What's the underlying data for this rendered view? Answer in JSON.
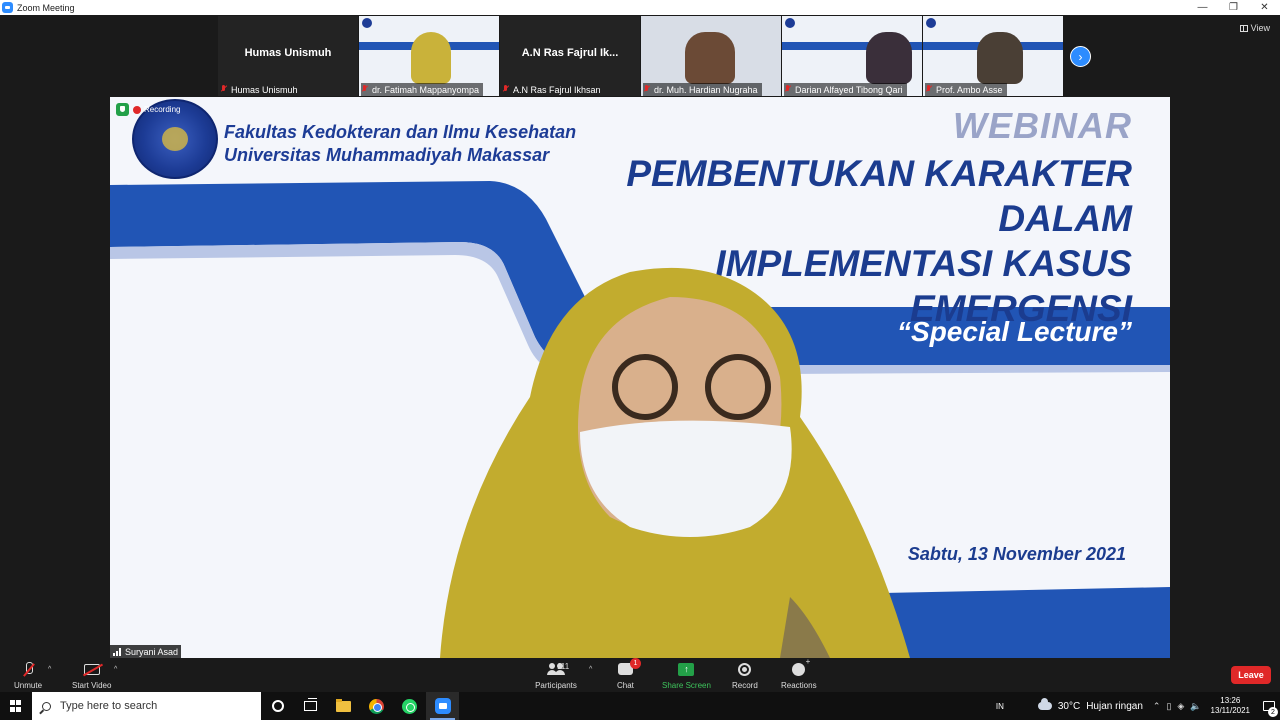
{
  "window": {
    "title": "Zoom Meeting",
    "controls": [
      "—",
      "❐",
      "✕"
    ]
  },
  "view_button": {
    "label": "View"
  },
  "participants_strip": [
    {
      "name": "Humas Unismuh",
      "caption": "Humas Unismuh",
      "video": false
    },
    {
      "caption": "dr. Fatimah Mappanyompa",
      "video": true
    },
    {
      "name": "A.N Ras Fajrul Ik...",
      "caption": "A.N Ras Fajrul Ikhsan",
      "video": false
    },
    {
      "caption": "dr. Muh. Hardian Nugraha",
      "video": true
    },
    {
      "caption": "Darian Alfayed Tibong Qari",
      "video": true
    },
    {
      "caption": "Prof. Ambo Asse",
      "video": true
    }
  ],
  "main_video": {
    "recording_label": "Recording",
    "speaker_name": "Suryani Asad",
    "slide": {
      "faculty_line1": "Fakultas Kedokteran dan Ilmu Kesehatan",
      "faculty_line2": "Universitas Muhammadiyah Makassar",
      "webinar": "WEBINAR",
      "title_line1": "PEMBENTUKAN KARAKTER DALAM",
      "title_line2": "IMPLEMENTASI KASUS",
      "title_line3": "EMERGENSI",
      "special": "“Special Lecture”",
      "date": "Sabtu, 13 November 2021"
    }
  },
  "toolbar": {
    "unmute": "Unmute",
    "start_video": "Start Video",
    "participants": "Participants",
    "participants_count": "111",
    "chat": "Chat",
    "chat_badge": "1",
    "share_screen": "Share Screen",
    "record": "Record",
    "reactions": "Reactions",
    "leave": "Leave"
  },
  "taskbar": {
    "search_placeholder": "Type here to search",
    "language": "IN",
    "temperature": "30°C",
    "weather": "Hujan ringan",
    "time": "13:26",
    "date": "13/11/2021",
    "notification_count": "2"
  },
  "colors": {
    "zoom_blue": "#2d8cff",
    "slide_blue": "#1b3c8f",
    "leave_red": "#e02828",
    "share_green": "#23a048"
  }
}
